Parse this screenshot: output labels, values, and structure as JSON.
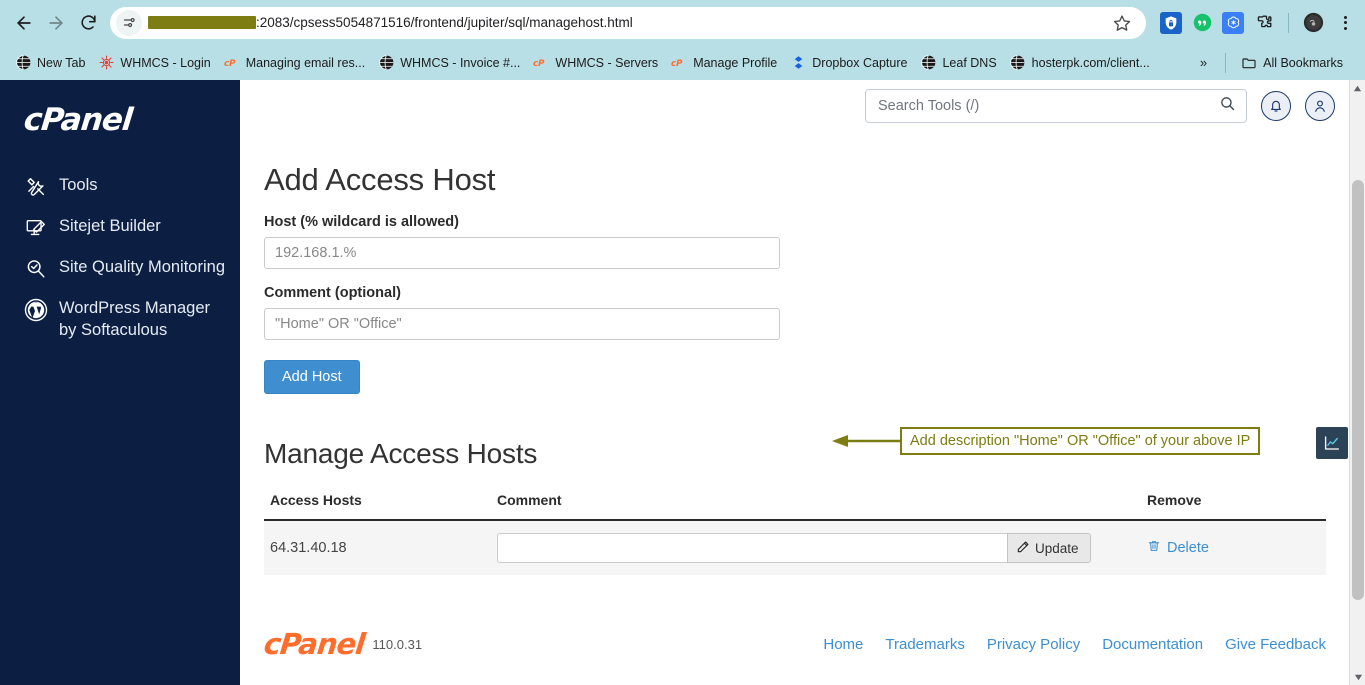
{
  "browser": {
    "nav": {
      "back_icon": "arrow-left-icon",
      "forward_icon": "arrow-right-icon",
      "reload_icon": "reload-icon"
    },
    "omnibox": {
      "site_info_icon": "tune-page-info-icon",
      "url_redacted": true,
      "url_visible": ":2083/cpsess5054871516/frontend/jupiter/sql/managehost.html",
      "star_icon": "bookmark-star-icon"
    },
    "extensions": [
      {
        "name": "password-manager-extension-icon",
        "glyph": "shield-lock"
      },
      {
        "name": "grammar-extension-icon",
        "glyph": "quote-circle"
      },
      {
        "name": "openai-extension-icon",
        "glyph": "openai"
      },
      {
        "name": "extensions-puzzle-icon",
        "glyph": "puzzle"
      }
    ],
    "profile_icon": "profile-avatar-icon",
    "menu_icon": "three-dot-menu-icon",
    "bookmarks": [
      {
        "label": "New Tab",
        "icon": "globe-icon"
      },
      {
        "label": "WHMCS - Login",
        "icon": "whmcs-icon"
      },
      {
        "label": "Managing email res...",
        "icon": "cpanel-icon"
      },
      {
        "label": "WHMCS - Invoice #...",
        "icon": "globe-icon"
      },
      {
        "label": "WHMCS - Servers",
        "icon": "cpanel-icon"
      },
      {
        "label": "Manage Profile",
        "icon": "cpanel-icon"
      },
      {
        "label": "Dropbox Capture",
        "icon": "dropbox-icon"
      },
      {
        "label": "Leaf DNS",
        "icon": "globe-icon"
      },
      {
        "label": "hosterpk.com/client...",
        "icon": "globe-icon"
      }
    ],
    "overflow_label": "»",
    "all_bookmarks_label": "All Bookmarks",
    "all_bookmarks_icon": "folder-icon"
  },
  "sidebar": {
    "logo": "cPanel",
    "items": [
      {
        "label": "Tools",
        "icon": "tools-icon"
      },
      {
        "label": "Sitejet Builder",
        "icon": "sitejet-monitor-icon"
      },
      {
        "label": "Site Quality Monitoring",
        "icon": "site-quality-magnifier-icon"
      },
      {
        "label": "WordPress Manager by Softaculous",
        "icon": "wordpress-icon"
      }
    ]
  },
  "header": {
    "search": {
      "placeholder": "Search Tools (/)",
      "value": "",
      "icon": "search-icon"
    },
    "notifications_icon": "bell-icon",
    "account_icon": "user-icon"
  },
  "main": {
    "add_host": {
      "title": "Add Access Host",
      "host_label": "Host (% wildcard is allowed)",
      "host_value": "192.168.1.%",
      "host_placeholder": "192.168.1.%",
      "comment_label": "Comment (optional)",
      "comment_value": "\"Home\" OR \"Office\"",
      "comment_placeholder": "\"Home\" OR \"Office\"",
      "submit_label": "Add Host"
    },
    "annotation": {
      "text": "Add description \"Home\" OR \"Office\" of your above IP",
      "color": "#7d7d14"
    },
    "manage": {
      "title": "Manage Access Hosts",
      "columns": [
        "Access Hosts",
        "Comment",
        "Remove"
      ],
      "rows": [
        {
          "host": "64.31.40.18",
          "comment_value": "",
          "update_label": "Update",
          "update_icon": "pencil-icon",
          "delete_label": "Delete",
          "delete_icon": "trash-icon"
        }
      ]
    },
    "side_widget_icon": "analytics-chart-icon"
  },
  "footer": {
    "logo": "cPanel",
    "version": "110.0.31",
    "links": [
      "Home",
      "Trademarks",
      "Privacy Policy",
      "Documentation",
      "Give Feedback"
    ]
  },
  "colors": {
    "chrome_bg": "#b8dfe6",
    "sidebar_bg": "#0c1f43",
    "primary_blue": "#3f8ed0",
    "link_blue": "#3d8fd1",
    "annotation_olive": "#7d7d14",
    "cpanel_orange": "#ff6c2c"
  }
}
